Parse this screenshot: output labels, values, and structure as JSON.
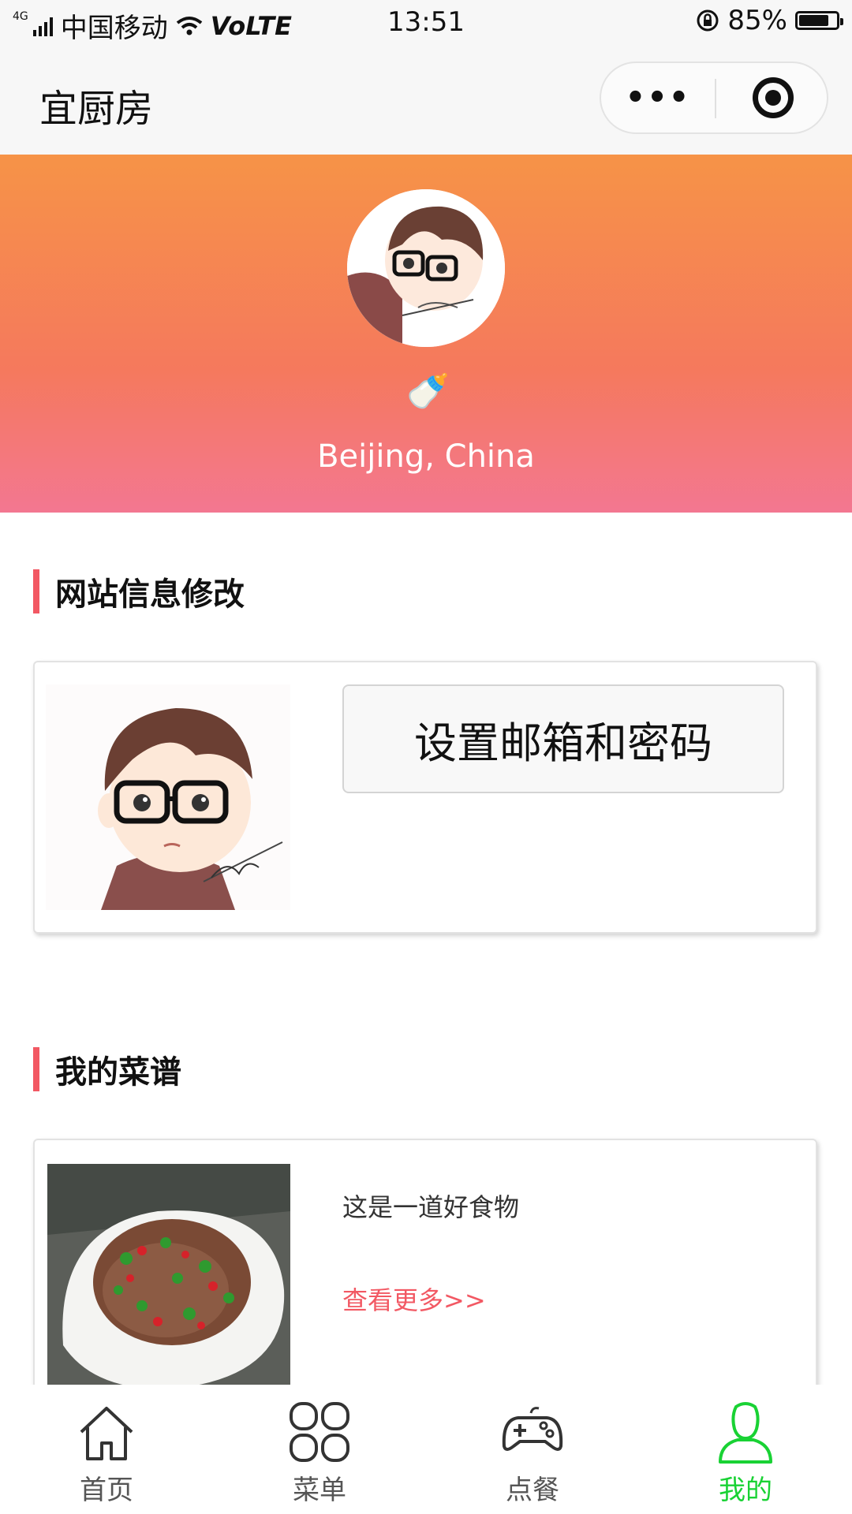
{
  "status_bar": {
    "network_type": "4G",
    "carrier": "中国移动",
    "volte": "VoLTE",
    "time": "13:51",
    "battery_percent": "85%",
    "battery_level": 0.85
  },
  "nav": {
    "title": "宜厨房",
    "more_label": "•••"
  },
  "profile": {
    "emoji": "🍼",
    "location": "Beijing, China"
  },
  "section_site": {
    "title": "网站信息修改",
    "button_label": "设置邮箱和密码"
  },
  "section_recipes": {
    "title": "我的菜谱",
    "description": "这是一道好食物",
    "more_link": "查看更多>>"
  },
  "tab_bar": {
    "items": [
      {
        "label": "首页",
        "icon": "home-icon"
      },
      {
        "label": "菜单",
        "icon": "menu-grid-icon"
      },
      {
        "label": "点餐",
        "icon": "gamepad-icon"
      },
      {
        "label": "我的",
        "icon": "user-icon"
      }
    ],
    "active_index": 3,
    "active_color": "#19d234"
  },
  "colors": {
    "accent": "#f25863",
    "gradient_top": "#f69347",
    "gradient_bottom": "#f37791"
  }
}
